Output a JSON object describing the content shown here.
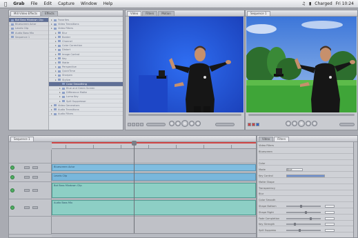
{
  "menubar": {
    "app": "Grab",
    "items": [
      "File",
      "Edit",
      "Capture",
      "Window",
      "Help"
    ],
    "status_right": [
      "Charged",
      "Fri 10:24"
    ]
  },
  "browser": {
    "tabs": [
      "Mill Video Effects",
      "Effects"
    ],
    "left_rows": [
      "Bot Bass Mixdown Clip",
      "Bluescreen Actor",
      "Levels Clip",
      "Audio Bass Mix",
      "Sequence 1"
    ],
    "right_rows": [
      {
        "label": "Favorites",
        "level": 0
      },
      {
        "label": "Video Transitions",
        "level": 0
      },
      {
        "label": "Video Filters",
        "level": 0
      },
      {
        "label": "Blur",
        "level": 1
      },
      {
        "label": "Border",
        "level": 1
      },
      {
        "label": "Channel",
        "level": 1
      },
      {
        "label": "Color Correction",
        "level": 1
      },
      {
        "label": "Distort",
        "level": 1
      },
      {
        "label": "Image Control",
        "level": 1
      },
      {
        "label": "Key",
        "level": 1
      },
      {
        "label": "Matte",
        "level": 1
      },
      {
        "label": "Perspective",
        "level": 1
      },
      {
        "label": "QuickTime",
        "level": 1
      },
      {
        "label": "Sharpen",
        "level": 1
      },
      {
        "label": "Stylize",
        "level": 1
      },
      {
        "label": "Color Smoothing",
        "level": 2,
        "selected": true
      },
      {
        "label": "Blue and Green Screen",
        "level": 2
      },
      {
        "label": "Difference Matte",
        "level": 2
      },
      {
        "label": "Luma Key",
        "level": 2
      },
      {
        "label": "Spill Suppressor",
        "level": 2
      },
      {
        "label": "Video Generators",
        "level": 0
      },
      {
        "label": "Audio Transitions",
        "level": 0
      },
      {
        "label": "Audio Filters",
        "level": 0
      }
    ]
  },
  "viewer": {
    "tabs": [
      "Video",
      "Filters",
      "Motion"
    ]
  },
  "canvas": {
    "tabs": [
      "Sequence 1"
    ]
  },
  "timeline": {
    "tabs": [
      "Sequence 1"
    ],
    "clips": [
      {
        "label": "Bluescreen Actor",
        "track": "V2"
      },
      {
        "label": "Levels Clip",
        "track": "V1"
      },
      {
        "label": "Bot Bass Mixdown Clip",
        "track": "A1"
      },
      {
        "label": "Audio Bass Mix",
        "track": "A2"
      }
    ]
  },
  "inspector": {
    "tabs": [
      "Video",
      "Filters"
    ],
    "rows": [
      "Video Filters",
      "Bluescreen",
      "",
      "Color",
      "Mode",
      "Key Control",
      "Matte Shape",
      "Transparency",
      "Blur",
      "Color Smooth",
      "Shape Bottom",
      "Shape Right",
      "Fade Completion",
      "Key Strength",
      "Spill Suppress"
    ],
    "mode_value": "Blue",
    "colors": {
      "key_blue": "#2150d9",
      "track_green": "#4fae62"
    }
  }
}
